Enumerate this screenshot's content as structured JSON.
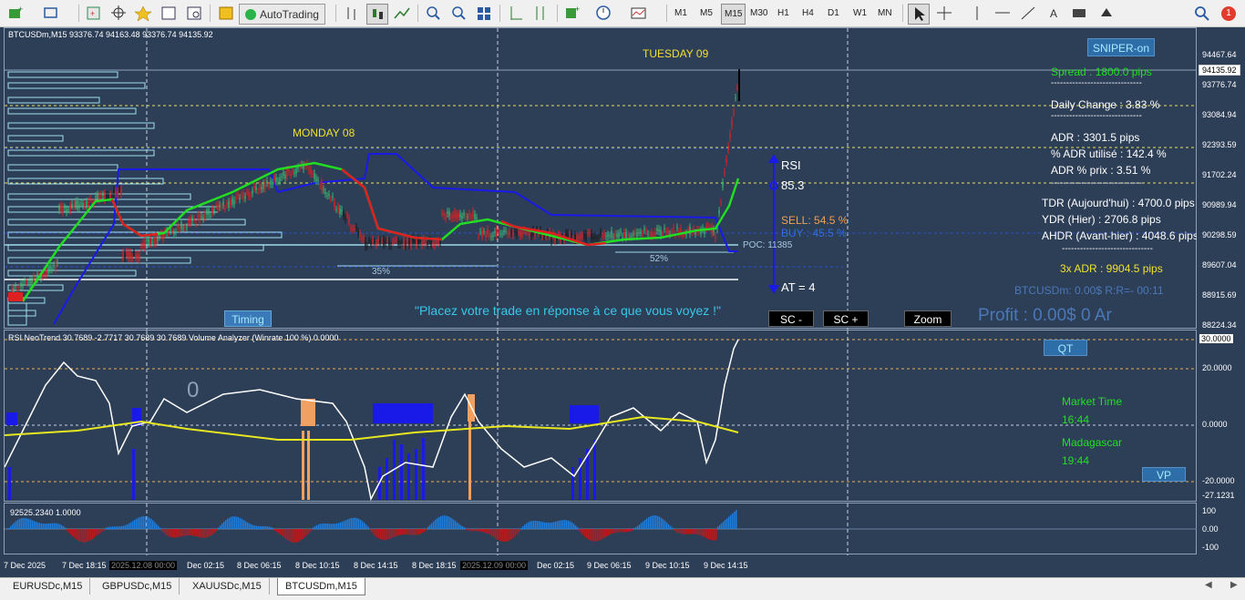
{
  "toolbar": {
    "auto_trading_label": "AutoTrading",
    "timeframes": [
      "M1",
      "M5",
      "M15",
      "M30",
      "H1",
      "H4",
      "D1",
      "W1",
      "MN"
    ],
    "active_timeframe": "M15",
    "notification_count": "1"
  },
  "main_chart": {
    "header": "BTCUSDm,M15  93376.74 94163.48 93376.74 94135.92",
    "current_price": "94135.92",
    "y_ticks": [
      "94467.64",
      "93776.74",
      "93084.94",
      "92393.59",
      "91702.24",
      "90989.94",
      "90298.59",
      "89607.04",
      "88915.69",
      "88224.34"
    ],
    "day_labels": {
      "monday": "MONDAY 08",
      "tuesday": "TUESDAY 09"
    },
    "rsi_label": "RSI",
    "rsi_value": "85.3",
    "sell_label": "SELL:  54.5 %",
    "buy_label": "BUY :  45.5 %",
    "poc_label": "POC: 11385",
    "pct_35": "35%",
    "pct_52": "52%",
    "at_label": "AT = 4",
    "quote": "\"Placez votre trade en réponse à ce que vous voyez !\"",
    "timing_button": "Timing",
    "sc_minus": "SC -",
    "sc_plus": "SC +",
    "zoom": "Zoom",
    "sniper": "SNIPER-on",
    "spread": "Spread : 1800.0 pips",
    "dash": "------------------------------",
    "daily_change": "Daily Change : 3.83 %",
    "adr": "ADR : 3301.5 pips",
    "adr_used": "% ADR utilisé : 142.4 %",
    "adr_price": "ADR % prix : 3.51 %",
    "tdr": "TDR (Aujourd'hui) : 4700.0 pips",
    "ydr": "YDR (Hier) : 2706.8 pips",
    "ahdr": "AHDR (Avant-hier) : 4048.6 pips",
    "adr3x": "3x ADR : 9904.5 pips",
    "btc_rr": "BTCUSDm: 0.00$  R:R=- 00:11",
    "profit": "Profit : 0.00$  0 Ar"
  },
  "rsi_panel": {
    "header": "RSI NeoTrend 30.7689 -2.7717 30.7689 30.7689  Volume Analyzer (Winrate 100 %) 0.0000",
    "zero_label": "0",
    "qt": "QT",
    "market_time_label": "Market Time",
    "market_time": "16:44",
    "madagascar_label": "Madagascar",
    "madagascar_time": "19:44",
    "vp": "VP",
    "y_ticks": [
      "30.0000",
      "20.0000",
      "0.0000",
      "-20.0000",
      "-27.1231"
    ]
  },
  "hist_panel": {
    "header": "92525.2340 1.0000",
    "y_ticks": [
      "100",
      "0.00",
      "-100"
    ]
  },
  "x_ticks": [
    "7 Dec 2025",
    "7 Dec 18:15",
    "2025.12.08 00:00",
    "Dec 02:15",
    "8 Dec 06:15",
    "8 Dec 10:15",
    "8 Dec 14:15",
    "8 Dec 18:15",
    "2025.12.09 00:00",
    "Dec 02:15",
    "9 Dec 06:15",
    "9 Dec 10:15",
    "9 Dec 14:15"
  ],
  "tabs": [
    "EURUSDc,M15",
    "GBPUSDc,M15",
    "XAUUSDc,M15",
    "BTCUSDm,M15"
  ],
  "active_tab": "BTCUSDm,M15",
  "colors": {
    "background": "#2d3e57",
    "bull": "#3cb371",
    "bear": "#e02020",
    "ma": "#22dd22",
    "band": "#1a1ae8",
    "rsi": "#ffffff",
    "signal": "#e8e820",
    "hist_blue": "#1a7fe0",
    "hist_red": "#c01818"
  }
}
